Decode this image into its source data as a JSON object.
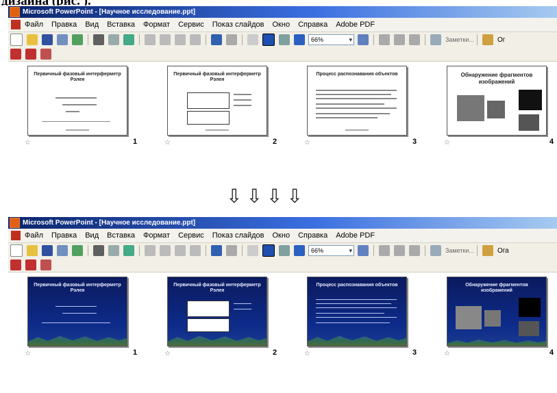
{
  "caption": "дизайна (рис. ).",
  "top_window": {
    "title": "Microsoft PowerPoint - [Научное исследование.ppt]",
    "menu": [
      "Файл",
      "Правка",
      "Вид",
      "Вставка",
      "Формат",
      "Сервис",
      "Показ слайдов",
      "Окно",
      "Справка",
      "Adobe PDF"
    ],
    "zoom": "66%",
    "notes_label": "Заметки...",
    "design_label": "Ог",
    "slides": [
      {
        "number": "1",
        "title": "Первичный фазовый интерферметр Рэлея"
      },
      {
        "number": "2",
        "title": "Первичный фазовый интерферметр Рэлея"
      },
      {
        "number": "3",
        "title": "Процесс распознавания объектов"
      },
      {
        "number": "4",
        "title": "Обнаружение фрагментов изображений"
      }
    ]
  },
  "arrows": "⇩⇩⇩⇩",
  "bottom_window": {
    "title": "Microsoft PowerPoint - [Научное исследование.ppt]",
    "menu": [
      "Файл",
      "Правка",
      "Вид",
      "Вставка",
      "Формат",
      "Сервис",
      "Показ слайдов",
      "Окно",
      "Справка",
      "Adobe PDF"
    ],
    "zoom": "66%",
    "notes_label": "Заметки...",
    "design_label": "Ога",
    "slides": [
      {
        "number": "1",
        "title": "Первичный фазовый интерферметр Рэлея"
      },
      {
        "number": "2",
        "title": "Первичный фазовый интерферметр Рэлея"
      },
      {
        "number": "3",
        "title": "Процесс распознавания объектов"
      },
      {
        "number": "4",
        "title": "Обнаружение фрагментов изображений"
      }
    ]
  },
  "colors": {
    "titlebar_start": "#0a246a",
    "titlebar_end": "#a6caf0",
    "design_bg": "#0d2b8a"
  }
}
